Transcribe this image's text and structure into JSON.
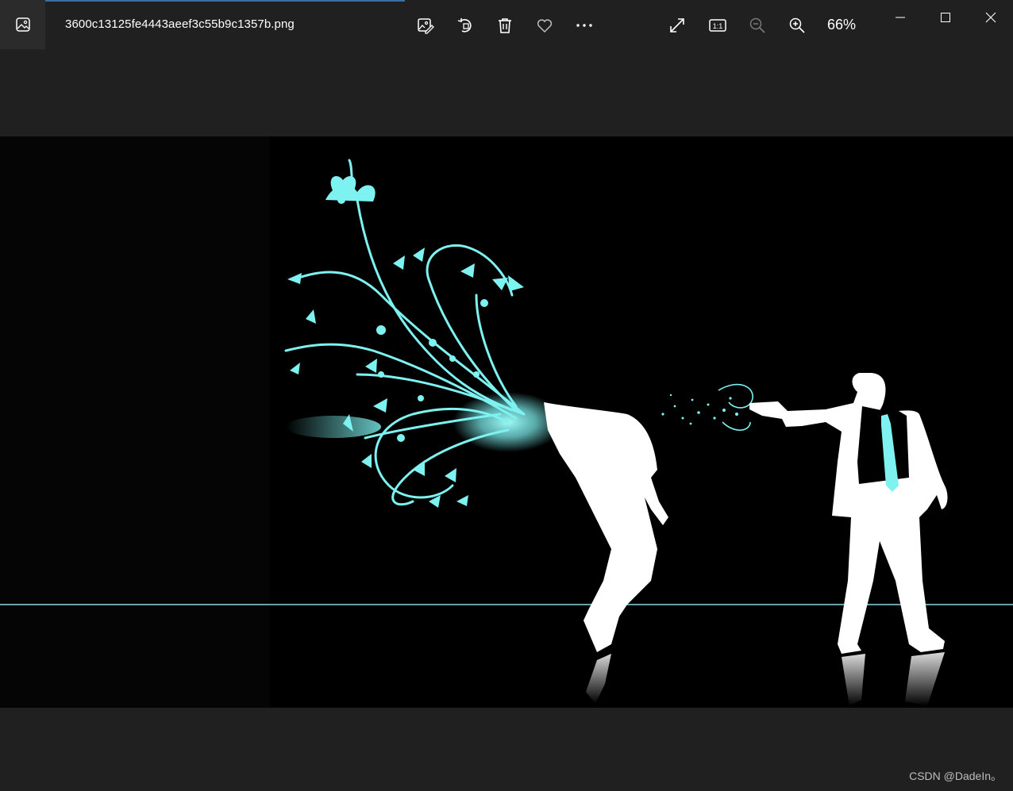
{
  "window": {
    "filename": "3600c13125fe4443aeef3c55b9c1357b.png",
    "zoom": "66%"
  },
  "toolbar": {
    "edit_icon": "edit-image-icon",
    "rotate_icon": "rotate-icon",
    "delete_icon": "trash-icon",
    "favorite_icon": "heart-icon",
    "more_icon": "more-icon",
    "fullscreen_icon": "expand-icon",
    "actual_size_icon": "actual-size-icon",
    "actual_size_label": "1:1",
    "zoom_out_icon": "zoom-out-icon",
    "zoom_in_icon": "zoom-in-icon"
  },
  "window_controls": {
    "minimize_icon": "minimize-icon",
    "maximize_icon": "maximize-icon",
    "close_icon": "close-icon"
  },
  "image": {
    "description_icon": "photo-content",
    "accent_color": "#7ef2f0",
    "figure_color": "#ffffff"
  },
  "watermark": "CSDN @DadeIn。",
  "colors": {
    "background": "#202020",
    "accent": "#3a6ea5",
    "cyan": "#7ef2f0"
  }
}
